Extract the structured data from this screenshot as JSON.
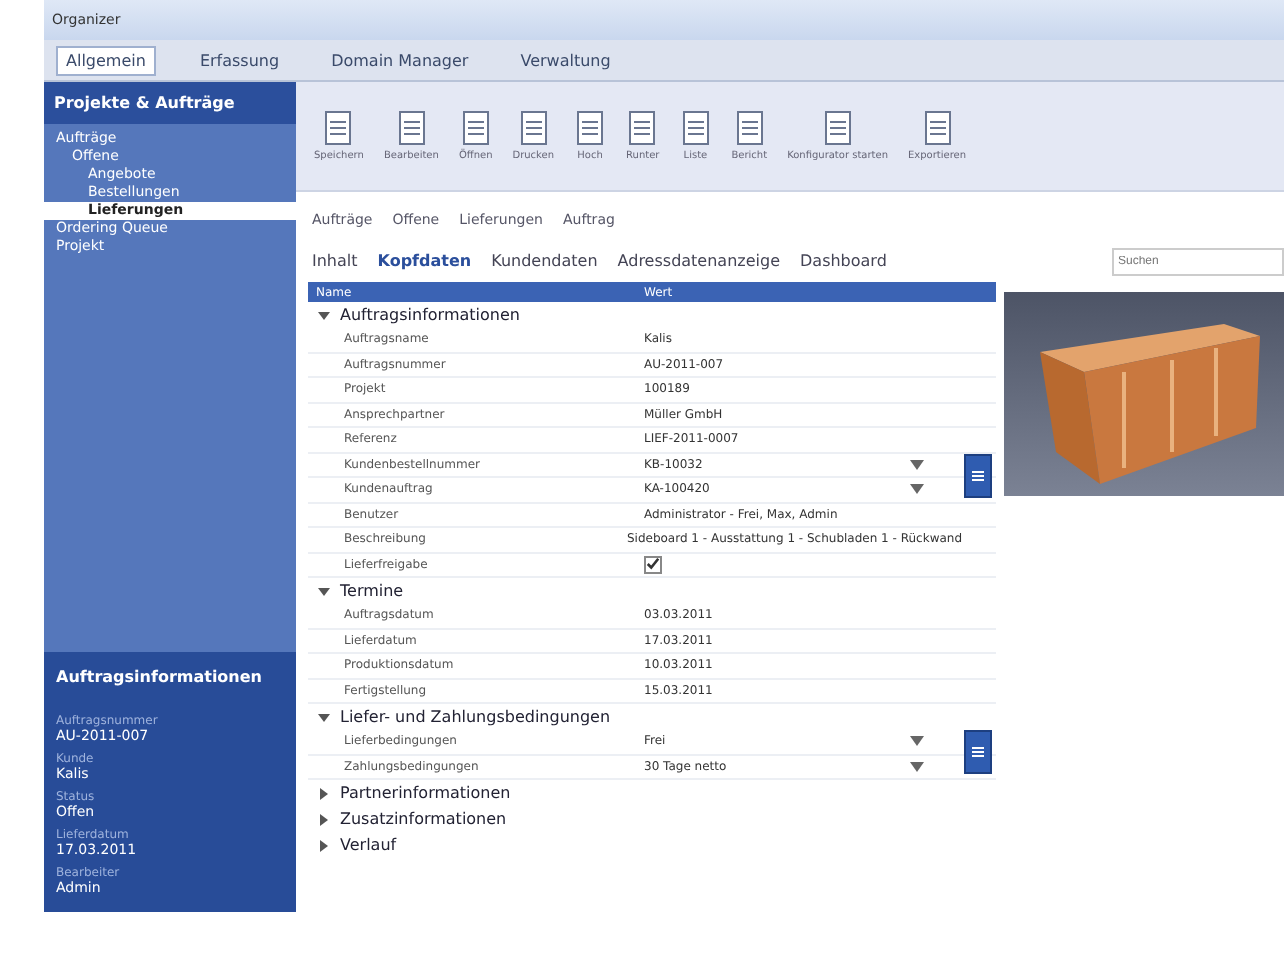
{
  "window": {
    "title": "Organizer"
  },
  "menu": [
    {
      "label": "Allgemein",
      "selected": true
    },
    {
      "label": "Erfassung",
      "selected": false
    },
    {
      "label": "Domain Manager",
      "selected": false
    },
    {
      "label": "Verwaltung",
      "selected": false
    }
  ],
  "sidebar": {
    "title": "Projekte & Aufträge",
    "tree": [
      {
        "label": "Aufträge",
        "selected": false,
        "children": [
          {
            "label": "Offene",
            "selected": false,
            "children": [
              {
                "label": "Angebote",
                "selected": false
              },
              {
                "label": "Bestellungen",
                "selected": false
              },
              {
                "label": "Lieferungen",
                "selected": true
              }
            ]
          }
        ]
      },
      {
        "label": "Ordering Queue",
        "selected": false
      },
      {
        "label": "Projekt",
        "selected": false
      }
    ],
    "info_title": "Auftragsinformationen",
    "info": [
      {
        "label": "Auftragsnummer",
        "value": "AU-2011-007"
      },
      {
        "label": "Kunde",
        "value": "Kalis"
      },
      {
        "label": "Status",
        "value": "Offen"
      },
      {
        "label": "Lieferdatum",
        "value": "17.03.2011"
      },
      {
        "label": "Bearbeiter",
        "value": "Admin"
      }
    ]
  },
  "toolbar": [
    "Speichern",
    "Bearbeiten",
    "Öffnen",
    "Drucken",
    "Hoch",
    "Runter",
    "Liste",
    "Bericht",
    "Konfigurator starten",
    "Exportieren"
  ],
  "breadcrumb": [
    "Aufträge",
    "Offene",
    "Lieferungen",
    "Auftrag"
  ],
  "tabs": [
    {
      "label": "Inhalt",
      "selected": false
    },
    {
      "label": "Kopfdaten",
      "selected": true
    },
    {
      "label": "Kundendaten",
      "selected": false
    },
    {
      "label": "Adressdatenanzeige",
      "selected": false
    },
    {
      "label": "Dashboard",
      "selected": false
    }
  ],
  "grid": {
    "columns": [
      "Name",
      "Wert"
    ],
    "sections": [
      {
        "title": "Auftragsinformationen",
        "expanded": true,
        "rows": [
          {
            "kind": "text",
            "label": "Auftragsname",
            "value": "Kalis"
          },
          {
            "kind": "text",
            "label": "Auftragsnummer",
            "value": "AU-2011-007"
          },
          {
            "kind": "text",
            "label": "Projekt",
            "value": "100189"
          },
          {
            "kind": "text",
            "label": "Ansprechpartner",
            "value": "Müller GmbH"
          },
          {
            "kind": "text",
            "label": "Referenz",
            "value": "LIEF-2011-0007"
          },
          {
            "kind": "dropdown",
            "label": "Kundenbestellnummer",
            "value": "KB-10032",
            "picker": true
          },
          {
            "kind": "dropdown",
            "label": "Kundenauftrag",
            "value": "KA-100420",
            "picker": true
          },
          {
            "kind": "text",
            "label": "Benutzer",
            "value": "Administrator - Frei, Max, Admin"
          },
          {
            "kind": "text",
            "label": "Beschreibung",
            "value": "Sideboard 1 - Ausstattung 1 - Schubladen 1 - Rückwand"
          },
          {
            "kind": "check",
            "label": "Lieferfreigabe",
            "checked": true
          }
        ]
      },
      {
        "title": "Termine",
        "expanded": true,
        "rows": [
          {
            "kind": "text",
            "label": "Auftragsdatum",
            "value": "03.03.2011"
          },
          {
            "kind": "text",
            "label": "Lieferdatum",
            "value": "17.03.2011"
          },
          {
            "kind": "text",
            "label": "Produktionsdatum",
            "value": "10.03.2011"
          },
          {
            "kind": "text",
            "label": "Fertigstellung",
            "value": "15.03.2011"
          }
        ]
      },
      {
        "title": "Liefer- und Zahlungsbedingungen",
        "expanded": true,
        "rows": [
          {
            "kind": "dropdown",
            "label": "Lieferbedingungen",
            "value": "Frei",
            "picker": true
          },
          {
            "kind": "dropdown",
            "label": "Zahlungsbedingungen",
            "value": "30 Tage netto",
            "picker": true
          }
        ]
      },
      {
        "title": "Partnerinformationen",
        "expanded": false
      },
      {
        "title": "Zusatzinformationen",
        "expanded": false
      },
      {
        "title": "Verlauf",
        "expanded": false
      }
    ]
  },
  "preview": {
    "search_placeholder": "Suchen"
  }
}
